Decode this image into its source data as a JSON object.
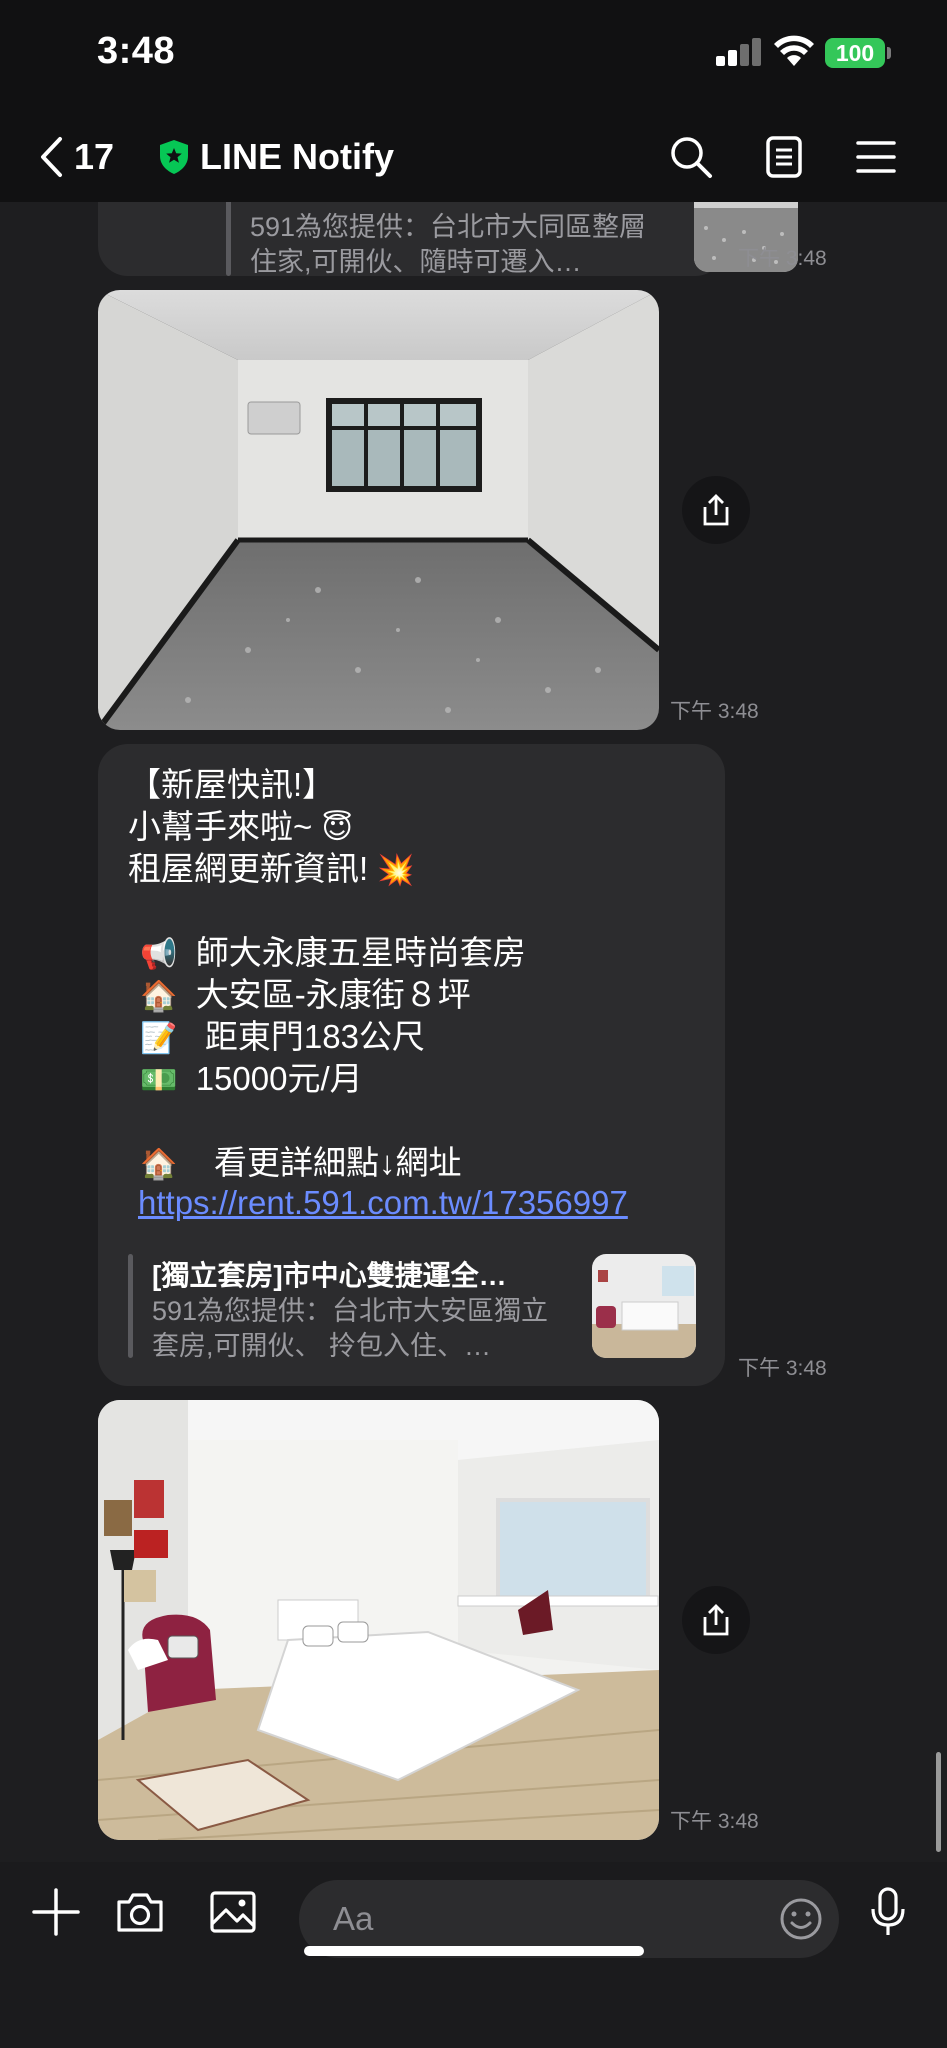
{
  "status_bar": {
    "time": "3:48",
    "battery": "100"
  },
  "header": {
    "back_count": "17",
    "title": "LINE Notify"
  },
  "messages": {
    "top_preview": {
      "desc": "591為您提供：台北市大同區整層住家,可開伙、隨時可遷入…",
      "time": "下午 3:48"
    },
    "image1": {
      "time": "下午 3:48"
    },
    "notice": {
      "line1": "【新屋快訊!】",
      "line2": "小幫手來啦~",
      "line3": "租屋網更新資訊!",
      "title_emoji": "📢",
      "title": "師大永康五星時尚套房",
      "area_emoji": "🏠",
      "area": "大安區-永康街８坪",
      "dist_emoji": "📝",
      "dist": " 距東門183公尺",
      "price_emoji": "💵",
      "price": "15000元/月",
      "more_emoji": "🏠",
      "more": "  看更詳細點↓網址",
      "link": "https://rent.591.com.tw/17356997",
      "preview_title": "[獨立套房]市中心雙捷運全…",
      "preview_desc": "591為您提供：台北市大安區獨立套房,可開伙、 拎包入住、…",
      "time": "下午 3:48"
    },
    "image2": {
      "time": "下午 3:48"
    }
  },
  "input": {
    "placeholder": "Aa"
  },
  "icons": {
    "back": "chevron-left-icon",
    "verified": "verified-shield-icon",
    "search": "search-icon",
    "notes": "notes-icon",
    "menu": "menu-icon",
    "share": "share-icon",
    "plus": "plus-icon",
    "camera": "camera-icon",
    "gallery": "image-icon",
    "emoji": "emoji-icon",
    "mic": "microphone-icon"
  },
  "colors": {
    "accent_link": "#6b8cff",
    "battery": "#34c759",
    "verified": "#06c755"
  }
}
